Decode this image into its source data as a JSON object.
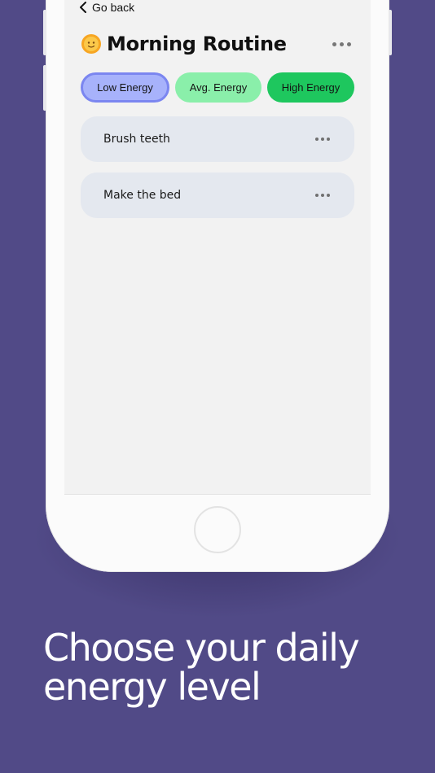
{
  "screen": {
    "back_label": "Go back",
    "title": "Morning Routine",
    "title_icon": "sun-face-icon",
    "energy_levels": [
      {
        "label": "Low Energy",
        "selected": true,
        "color": "#a7b2fb"
      },
      {
        "label": "Avg. Energy",
        "selected": false,
        "color": "#8aefaa"
      },
      {
        "label": "High Energy",
        "selected": false,
        "color": "#1ec75e"
      }
    ],
    "tasks": [
      {
        "label": "Brush teeth"
      },
      {
        "label": "Make the bed"
      }
    ]
  },
  "promo": {
    "headline_line1": "Choose your daily",
    "headline_line2": "energy level"
  },
  "colors": {
    "background": "#514a87",
    "card": "#e4e8ef",
    "selected_border": "#7b86f0"
  }
}
